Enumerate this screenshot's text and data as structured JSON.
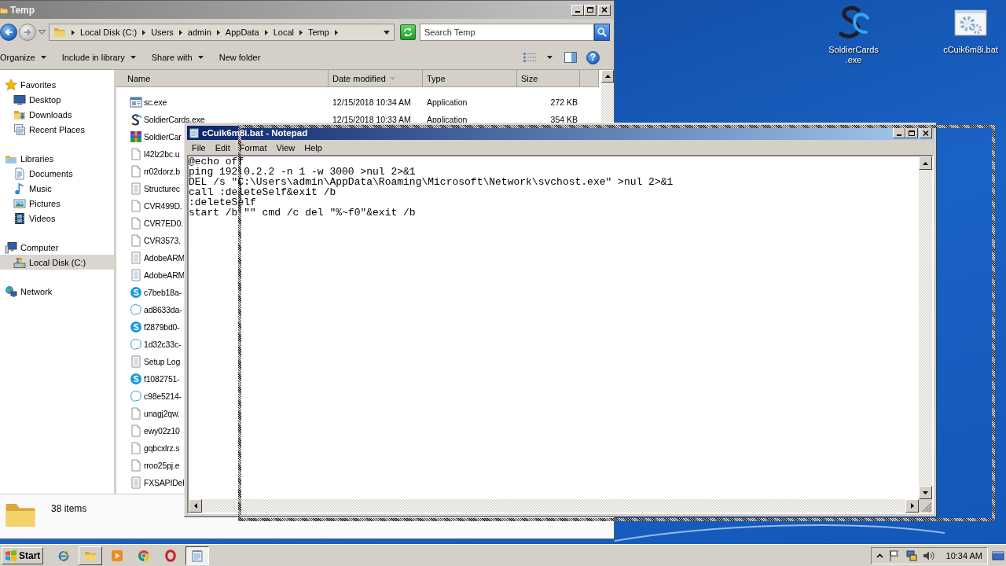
{
  "desktop": {
    "icons": [
      {
        "label": "SoldierCards\n.exe",
        "kind": "s-logo"
      },
      {
        "label": "cCuik6m8i.bat",
        "kind": "batch"
      }
    ]
  },
  "explorer": {
    "title": "Temp",
    "active": false,
    "breadcrumb": [
      "Local Disk (C:)",
      "Users",
      "admin",
      "AppData",
      "Local",
      "Temp"
    ],
    "search": {
      "placeholder": "Search Temp"
    },
    "commands": [
      {
        "label": "Organize",
        "dropdown": true
      },
      {
        "label": "Include in library",
        "dropdown": true
      },
      {
        "label": "Share with",
        "dropdown": true
      },
      {
        "label": "New folder",
        "dropdown": false
      }
    ],
    "help": "?",
    "nav": [
      {
        "label": "Favorites",
        "kind": "favorites",
        "selected": false,
        "children": [
          {
            "label": "Desktop",
            "kind": "desktop",
            "selected": false
          },
          {
            "label": "Downloads",
            "kind": "downloads",
            "selected": false
          },
          {
            "label": "Recent Places",
            "kind": "recent",
            "selected": false
          }
        ]
      },
      {
        "label": "Libraries",
        "kind": "libraries",
        "selected": false,
        "children": [
          {
            "label": "Documents",
            "kind": "documents",
            "selected": false
          },
          {
            "label": "Music",
            "kind": "music",
            "selected": false
          },
          {
            "label": "Pictures",
            "kind": "pictures",
            "selected": false
          },
          {
            "label": "Videos",
            "kind": "videos",
            "selected": false
          }
        ]
      },
      {
        "label": "Computer",
        "kind": "computer",
        "selected": false,
        "children": [
          {
            "label": "Local Disk (C:)",
            "kind": "drive",
            "selected": true
          }
        ]
      },
      {
        "label": "Network",
        "kind": "network",
        "selected": false
      }
    ],
    "columns": [
      {
        "label": "Name",
        "sorted": false
      },
      {
        "label": "Date modified",
        "sorted": true
      },
      {
        "label": "Type",
        "sorted": false
      },
      {
        "label": "Size",
        "sorted": false
      }
    ],
    "files": [
      {
        "name": "sc.exe",
        "kind": "application",
        "date": "12/15/2018 10:34 AM",
        "type": "Application",
        "size": "272 KB"
      },
      {
        "name": "SoldierCards.exe",
        "kind": "s-logo",
        "date": "12/15/2018 10:33 AM",
        "type": "Application",
        "size": "354 KB"
      },
      {
        "name": "SoldierCar",
        "kind": "archive"
      },
      {
        "name": "l42lz2bc.u",
        "kind": "file"
      },
      {
        "name": "rr02dorz.b",
        "kind": "file"
      },
      {
        "name": "Structurec",
        "kind": "text"
      },
      {
        "name": "CVR499D.",
        "kind": "file"
      },
      {
        "name": "CVR7ED0.",
        "kind": "file"
      },
      {
        "name": "CVR3573.",
        "kind": "file"
      },
      {
        "name": "AdobeARM",
        "kind": "text"
      },
      {
        "name": "AdobeARM",
        "kind": "text"
      },
      {
        "name": "c7beb18a-",
        "kind": "s-badge"
      },
      {
        "name": "ad8633da-",
        "kind": "blob"
      },
      {
        "name": "f2879bd0-",
        "kind": "s-badge"
      },
      {
        "name": "1d32c33c-",
        "kind": "blob"
      },
      {
        "name": "Setup Log",
        "kind": "text"
      },
      {
        "name": "f1082751-",
        "kind": "s-badge"
      },
      {
        "name": "c98e5214-",
        "kind": "blob"
      },
      {
        "name": "unagj2qw.",
        "kind": "file"
      },
      {
        "name": "ewy02z10",
        "kind": "file"
      },
      {
        "name": "gqbcxlrz.s",
        "kind": "file"
      },
      {
        "name": "rroo25pj.e",
        "kind": "file"
      },
      {
        "name": "FXSAPIDel",
        "kind": "text"
      }
    ],
    "status": "38 items"
  },
  "notepad": {
    "title": "cCuik6m8i.bat - Notepad",
    "active": true,
    "menu": [
      "File",
      "Edit",
      "Format",
      "View",
      "Help"
    ],
    "lines": [
      "@echo off",
      "ping 192.0.2.2 -n 1 -w 3000 >nul 2>&1",
      "DEL /s \"C:\\Users\\admin\\AppData\\Roaming\\Microsoft\\Network\\svchost.exe\" >nul 2>&1",
      "call :deleteSelf&exit /b",
      ":deleteSelf",
      "start /b \"\" cmd /c del \"%~f0\"&exit /b"
    ]
  },
  "taskbar": {
    "start": "Start",
    "items": [
      {
        "kind": "ie",
        "open": false,
        "selected": false
      },
      {
        "kind": "explorer",
        "open": true,
        "selected": false
      },
      {
        "kind": "media",
        "open": false,
        "selected": false
      },
      {
        "kind": "chrome",
        "open": false,
        "selected": false
      },
      {
        "kind": "opera",
        "open": false,
        "selected": false
      },
      {
        "kind": "notepad",
        "open": true,
        "selected": true
      }
    ],
    "clock": "10:34 AM"
  }
}
